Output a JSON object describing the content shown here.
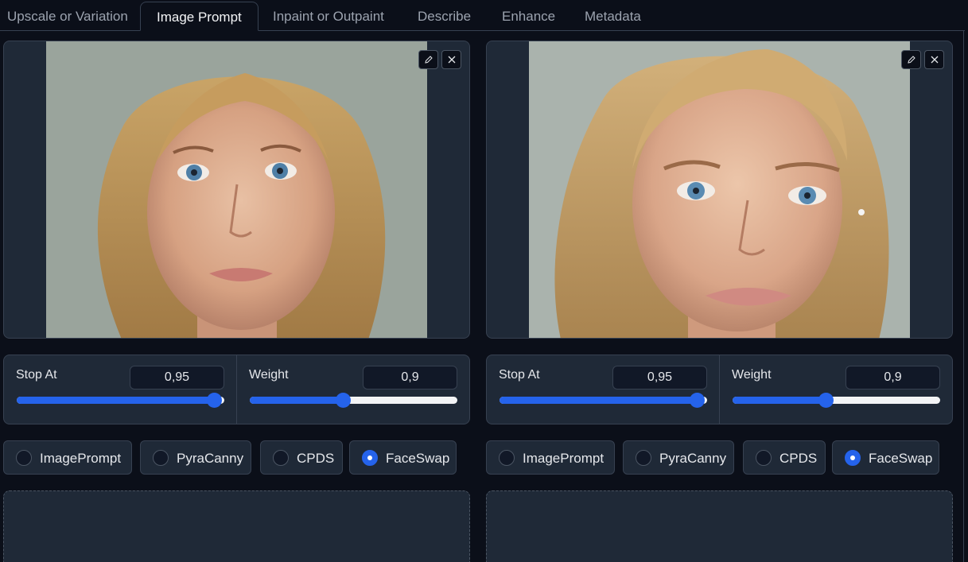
{
  "tabs": [
    {
      "label": "Upscale or Variation",
      "active": false
    },
    {
      "label": "Image Prompt",
      "active": true
    },
    {
      "label": "Inpaint or Outpaint",
      "active": false
    },
    {
      "label": "Describe",
      "active": false
    },
    {
      "label": "Enhance",
      "active": false
    },
    {
      "label": "Metadata",
      "active": false
    }
  ],
  "icons": {
    "edit": "pencil-icon",
    "clear": "close-icon"
  },
  "colors": {
    "accent": "#2563eb",
    "background": "#0b0f19",
    "panel": "#1f2937",
    "border": "#374151"
  },
  "columns": [
    {
      "stop_at": {
        "label": "Stop At",
        "value": "0,95",
        "fraction": 0.95
      },
      "weight": {
        "label": "Weight",
        "value": "0,9",
        "fraction": 0.45
      },
      "options": [
        {
          "label": "ImagePrompt",
          "checked": false
        },
        {
          "label": "PyraCanny",
          "checked": false
        },
        {
          "label": "CPDS",
          "checked": false
        },
        {
          "label": "FaceSwap",
          "checked": true
        }
      ]
    },
    {
      "stop_at": {
        "label": "Stop At",
        "value": "0,95",
        "fraction": 0.95
      },
      "weight": {
        "label": "Weight",
        "value": "0,9",
        "fraction": 0.45
      },
      "options": [
        {
          "label": "ImagePrompt",
          "checked": false
        },
        {
          "label": "PyraCanny",
          "checked": false
        },
        {
          "label": "CPDS",
          "checked": false
        },
        {
          "label": "FaceSwap",
          "checked": true
        }
      ]
    }
  ]
}
